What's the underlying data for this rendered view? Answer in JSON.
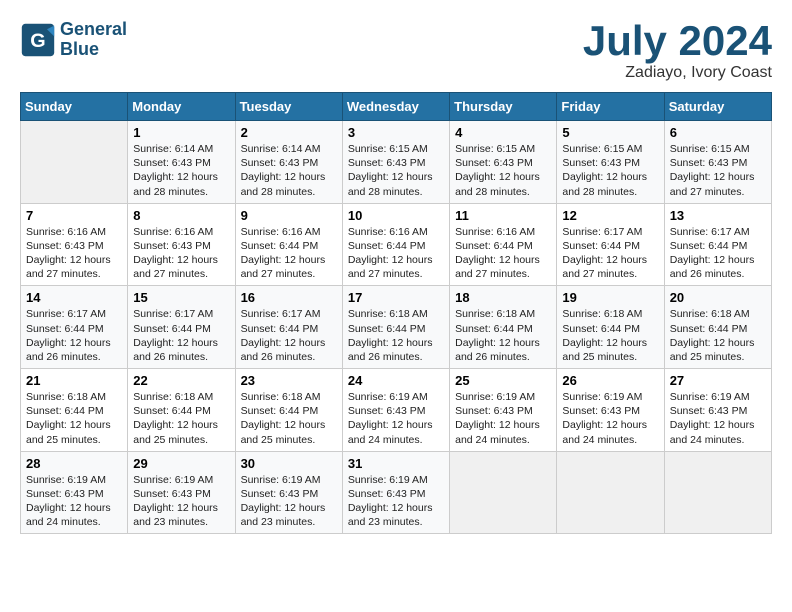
{
  "header": {
    "logo_line1": "General",
    "logo_line2": "Blue",
    "month": "July 2024",
    "location": "Zadiayo, Ivory Coast"
  },
  "days_of_week": [
    "Sunday",
    "Monday",
    "Tuesday",
    "Wednesday",
    "Thursday",
    "Friday",
    "Saturday"
  ],
  "weeks": [
    [
      {
        "day": "",
        "info": ""
      },
      {
        "day": "1",
        "info": "Sunrise: 6:14 AM\nSunset: 6:43 PM\nDaylight: 12 hours\nand 28 minutes."
      },
      {
        "day": "2",
        "info": "Sunrise: 6:14 AM\nSunset: 6:43 PM\nDaylight: 12 hours\nand 28 minutes."
      },
      {
        "day": "3",
        "info": "Sunrise: 6:15 AM\nSunset: 6:43 PM\nDaylight: 12 hours\nand 28 minutes."
      },
      {
        "day": "4",
        "info": "Sunrise: 6:15 AM\nSunset: 6:43 PM\nDaylight: 12 hours\nand 28 minutes."
      },
      {
        "day": "5",
        "info": "Sunrise: 6:15 AM\nSunset: 6:43 PM\nDaylight: 12 hours\nand 28 minutes."
      },
      {
        "day": "6",
        "info": "Sunrise: 6:15 AM\nSunset: 6:43 PM\nDaylight: 12 hours\nand 27 minutes."
      }
    ],
    [
      {
        "day": "7",
        "info": "Sunrise: 6:16 AM\nSunset: 6:43 PM\nDaylight: 12 hours\nand 27 minutes."
      },
      {
        "day": "8",
        "info": "Sunrise: 6:16 AM\nSunset: 6:43 PM\nDaylight: 12 hours\nand 27 minutes."
      },
      {
        "day": "9",
        "info": "Sunrise: 6:16 AM\nSunset: 6:44 PM\nDaylight: 12 hours\nand 27 minutes."
      },
      {
        "day": "10",
        "info": "Sunrise: 6:16 AM\nSunset: 6:44 PM\nDaylight: 12 hours\nand 27 minutes."
      },
      {
        "day": "11",
        "info": "Sunrise: 6:16 AM\nSunset: 6:44 PM\nDaylight: 12 hours\nand 27 minutes."
      },
      {
        "day": "12",
        "info": "Sunrise: 6:17 AM\nSunset: 6:44 PM\nDaylight: 12 hours\nand 27 minutes."
      },
      {
        "day": "13",
        "info": "Sunrise: 6:17 AM\nSunset: 6:44 PM\nDaylight: 12 hours\nand 26 minutes."
      }
    ],
    [
      {
        "day": "14",
        "info": "Sunrise: 6:17 AM\nSunset: 6:44 PM\nDaylight: 12 hours\nand 26 minutes."
      },
      {
        "day": "15",
        "info": "Sunrise: 6:17 AM\nSunset: 6:44 PM\nDaylight: 12 hours\nand 26 minutes."
      },
      {
        "day": "16",
        "info": "Sunrise: 6:17 AM\nSunset: 6:44 PM\nDaylight: 12 hours\nand 26 minutes."
      },
      {
        "day": "17",
        "info": "Sunrise: 6:18 AM\nSunset: 6:44 PM\nDaylight: 12 hours\nand 26 minutes."
      },
      {
        "day": "18",
        "info": "Sunrise: 6:18 AM\nSunset: 6:44 PM\nDaylight: 12 hours\nand 26 minutes."
      },
      {
        "day": "19",
        "info": "Sunrise: 6:18 AM\nSunset: 6:44 PM\nDaylight: 12 hours\nand 25 minutes."
      },
      {
        "day": "20",
        "info": "Sunrise: 6:18 AM\nSunset: 6:44 PM\nDaylight: 12 hours\nand 25 minutes."
      }
    ],
    [
      {
        "day": "21",
        "info": "Sunrise: 6:18 AM\nSunset: 6:44 PM\nDaylight: 12 hours\nand 25 minutes."
      },
      {
        "day": "22",
        "info": "Sunrise: 6:18 AM\nSunset: 6:44 PM\nDaylight: 12 hours\nand 25 minutes."
      },
      {
        "day": "23",
        "info": "Sunrise: 6:18 AM\nSunset: 6:44 PM\nDaylight: 12 hours\nand 25 minutes."
      },
      {
        "day": "24",
        "info": "Sunrise: 6:19 AM\nSunset: 6:43 PM\nDaylight: 12 hours\nand 24 minutes."
      },
      {
        "day": "25",
        "info": "Sunrise: 6:19 AM\nSunset: 6:43 PM\nDaylight: 12 hours\nand 24 minutes."
      },
      {
        "day": "26",
        "info": "Sunrise: 6:19 AM\nSunset: 6:43 PM\nDaylight: 12 hours\nand 24 minutes."
      },
      {
        "day": "27",
        "info": "Sunrise: 6:19 AM\nSunset: 6:43 PM\nDaylight: 12 hours\nand 24 minutes."
      }
    ],
    [
      {
        "day": "28",
        "info": "Sunrise: 6:19 AM\nSunset: 6:43 PM\nDaylight: 12 hours\nand 24 minutes."
      },
      {
        "day": "29",
        "info": "Sunrise: 6:19 AM\nSunset: 6:43 PM\nDaylight: 12 hours\nand 23 minutes."
      },
      {
        "day": "30",
        "info": "Sunrise: 6:19 AM\nSunset: 6:43 PM\nDaylight: 12 hours\nand 23 minutes."
      },
      {
        "day": "31",
        "info": "Sunrise: 6:19 AM\nSunset: 6:43 PM\nDaylight: 12 hours\nand 23 minutes."
      },
      {
        "day": "",
        "info": ""
      },
      {
        "day": "",
        "info": ""
      },
      {
        "day": "",
        "info": ""
      }
    ]
  ]
}
